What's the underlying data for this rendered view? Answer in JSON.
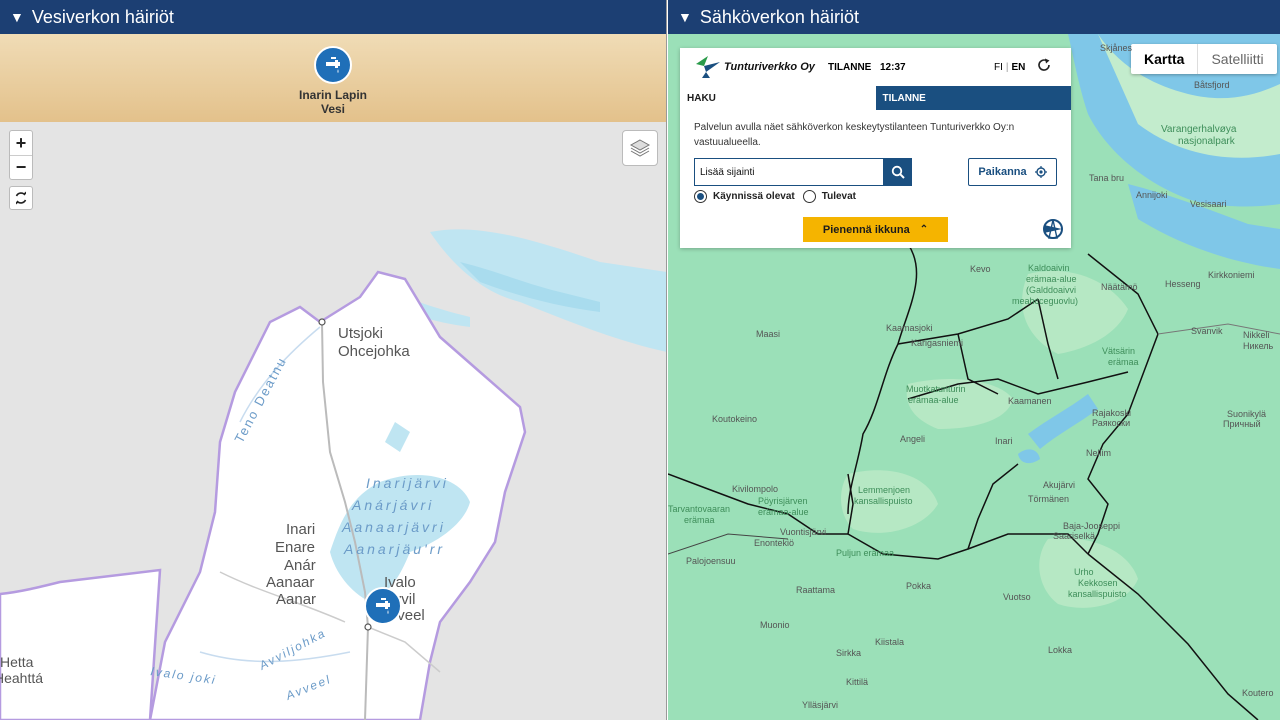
{
  "left_panel": {
    "title": "Vesiverkon häiriöt",
    "provider_label": "Inarin Lapin Vesi",
    "zoom_in": "+",
    "zoom_out": "−",
    "map_labels": {
      "utsjoki": "Utsjoki",
      "ohcejohka": "Ohcejohka",
      "teno": "Teno Deatnu",
      "inarijarvi_1": "Inarijärvi",
      "inarijarvi_2": "Anárjávri",
      "inarijarvi_3": "Aanaarjävri",
      "inarijarvi_4": "Aanarjäu'rr",
      "inari_1": "Inari",
      "inari_2": "Enare",
      "inari_3": "Anár",
      "inari_4": "Aanaar",
      "inari_5": "Aanar",
      "ivalo_1": "Ivalo",
      "ivalo_2": "Avvil",
      "ivalo_3": "Avveel",
      "hetta_1": "Hetta",
      "hetta_2": "Heahttá",
      "avvil_river": "Avviljohka",
      "avveel_river": "Avveel",
      "ivalojoki": "Ivalo joki"
    }
  },
  "right_panel": {
    "title": "Sähköverkon häiriöt",
    "map_type": {
      "map": "Kartta",
      "satellite": "Satelliitti"
    },
    "widget": {
      "company": "Tunturiverkko Oy",
      "tilanne": "TILANNE",
      "time": "12:37",
      "lang_fi": "FI",
      "lang_sep": "|",
      "lang_en": "EN",
      "tabs": {
        "haku": "HAKU",
        "tilanne": "TILANNE"
      },
      "description": "Palvelun avulla näet sähköverkon keskeytystilanteen Tunturiverkko Oy:n vastuualueella.",
      "search_value": "Lisää sijainti",
      "locate_label": "Paikanna",
      "radio_active": "Käynnissä olevat",
      "radio_upcoming": "Tulevat",
      "shrink_label": "Pienennä ikkuna"
    },
    "map_labels": {
      "skjanes": "Skjånes",
      "batsfjord": "Båtsfjord",
      "varanger_1": "Varangerhalvøya",
      "varanger_2": "nasjonalpark",
      "tana_bru": "Tana bru",
      "annijoki": "Annijoki",
      "vesisaari": "Vesisaari",
      "kevo": "Kevo",
      "kaldoaivi_1": "Kaldoaivin",
      "kaldoaivi_2": "erämaa-alue",
      "kaldoaivi_3": "(Galddoaivvi",
      "kaldoaivi_4": "meahcceguovlu)",
      "naatamo": "Näätämö",
      "kirkkoniemi": "Kirkkoniemi",
      "hesseng": "Hesseng",
      "svanvik": "Svanvik",
      "nikkeli_1": "Nikkeli",
      "nikkeli_2": "Никель",
      "maasi": "Maasi",
      "kaamasjoki": "Kaamasjoki",
      "karigasniemi": "Karigasniemi",
      "vatsari_1": "Vätsärin",
      "vatsari_2": "erämaa",
      "muotka_1": "Muotkatunturin",
      "muotka_2": "erämaa-alue",
      "kaamanen": "Kaamanen",
      "kautokeino": "Koutokeino",
      "rajakoski_1": "Rajakoski",
      "rajakoski_2": "Раякоски",
      "suonikyla_1": "Suonikylä",
      "suonikyla_2": "Причный",
      "angeli": "Angeli",
      "inari": "Inari",
      "nellim": "Nellim",
      "akujarvi": "Akujärvi",
      "tormanen": "Törmänen",
      "kivilompolo": "Kivilompolo",
      "poyrisjarvi_1": "Pöyrisjärven",
      "poyrisjarvi_2": "erämaa-alue",
      "lemmenjoki_1": "Lemmenjoen",
      "lemmenjoki_2": "kansallispuisto",
      "tarvantovaara_1": "Tarvantovaaran",
      "tarvantovaara_2": "erämaa",
      "vuontisjarvi": "Vuontisjärvi",
      "enontekio": "Enontekiö",
      "baja_jooseppi": "Baja-Jooseppi",
      "saariselka": "Saariselkä",
      "puljun": "Puljun erämaa",
      "palojoensuu": "Palojoensuu",
      "urho_1": "Urho",
      "urho_2": "Kekkosen",
      "urho_3": "kansallispuisto",
      "raattama": "Raattama",
      "pokka": "Pokka",
      "vuotso": "Vuotso",
      "muonio": "Muonio",
      "kiistala": "Kiistala",
      "sirkka": "Sirkka",
      "lokka": "Lokka",
      "kittila": "Kittilä",
      "ylasjarvi": "Ylläsjärvi",
      "koutero": "Koutero"
    }
  }
}
